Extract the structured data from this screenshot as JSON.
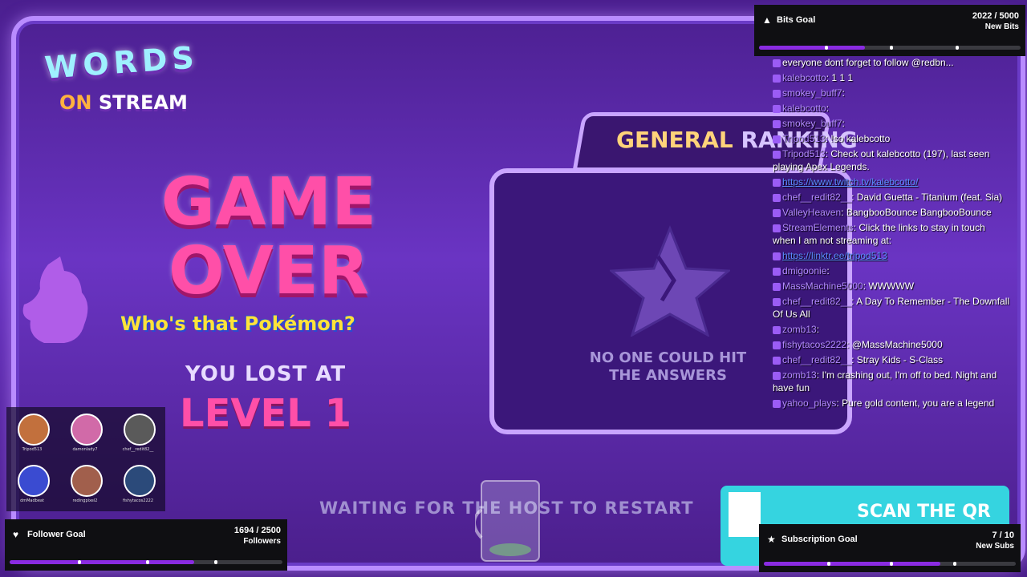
{
  "logo": {
    "words": "WORDS",
    "on": "ON",
    "stream": "STREAM"
  },
  "game": {
    "title_line1": "GAME",
    "title_line2": "OVER",
    "whos_that": "Who's that Pokémon?",
    "lost_label": "YOU LOST AT",
    "level": "LEVEL 1",
    "ranking_title": "GENERAL",
    "ranking_title_cont": "RANKING",
    "no_answers": "NO ONE COULD HIT THE ANSWERS",
    "waiting": "WAITING FOR THE HOST TO RESTART",
    "qr_text": "SCAN THE QR"
  },
  "avatars": [
    {
      "name": "Tripod513",
      "color": "#c2703d"
    },
    {
      "name": "damonlady7",
      "color": "#d16aa8"
    },
    {
      "name": "chef__redit82__",
      "color": "#5a5a5a"
    },
    {
      "name": "dmMadbeat",
      "color": "#3a4bd1"
    },
    {
      "name": "redingpixel2",
      "color": "#a15f4c"
    },
    {
      "name": "fishytacos2222",
      "color": "#2b4a7a"
    }
  ],
  "goals": {
    "bits": {
      "title": "Bits Goal",
      "count": "2022 / 5000",
      "unit": "New Bits",
      "progress": 0.4044,
      "icon": "bits-icon"
    },
    "followers": {
      "title": "Follower Goal",
      "count": "1694 / 2500",
      "unit": "Followers",
      "progress": 0.6776,
      "icon": "heart-icon"
    },
    "subs": {
      "title": "Subscription Goal",
      "count": "7 / 10",
      "unit": "New Subs",
      "progress": 0.7,
      "icon": "star-icon"
    }
  },
  "chat": [
    {
      "user": "",
      "text": "everyone dont forget to follow @redbn..."
    },
    {
      "user": "kalebcotto",
      "text": "1 1 1"
    },
    {
      "user": "smokey_buff7",
      "text": ""
    },
    {
      "user": "kalebcotto",
      "text": ""
    },
    {
      "user": "smokey_buff7",
      "text": ""
    },
    {
      "user": "Tripod513",
      "text": "!so kalebcotto"
    },
    {
      "user": "Tripod513",
      "text": "Check out kalebcotto (197), last seen playing Apex Legends."
    },
    {
      "user": "",
      "text": "https://www.twitch.tv/kalebcotto/",
      "link": true
    },
    {
      "user": "chef__redit82__",
      "text": "David Guetta - Titanium (feat. Sia)"
    },
    {
      "user": "ValleyHeaven",
      "text": "BangbooBounce BangbooBounce"
    },
    {
      "user": "StreamElements",
      "text": "Click the links to stay in touch when I am not streaming at:"
    },
    {
      "user": "",
      "text": "https://linktr.ee/tripod513",
      "link": true
    },
    {
      "user": "dmigoonie",
      "text": ""
    },
    {
      "user": "MassMachine5000",
      "text": "WWWWW"
    },
    {
      "user": "chef__redit82__",
      "text": "A Day To Remember - The Downfall Of Us All"
    },
    {
      "user": "zomb13",
      "text": ""
    },
    {
      "user": "fishytacos2222",
      "text": "@MassMachine5000"
    },
    {
      "user": "chef__redit82__",
      "text": "Stray Kids - S-Class"
    },
    {
      "user": "zomb13",
      "text": "I'm crashing out, I'm off to bed. Night and have fun"
    },
    {
      "user": "yahoo_plays",
      "text": "Pure gold content, you are a legend"
    }
  ],
  "colors": {
    "accent": "#8a2be2",
    "pink": "#ff4fa8",
    "purple_bg": "#6a34c3",
    "yellow": "#ffe23a"
  }
}
